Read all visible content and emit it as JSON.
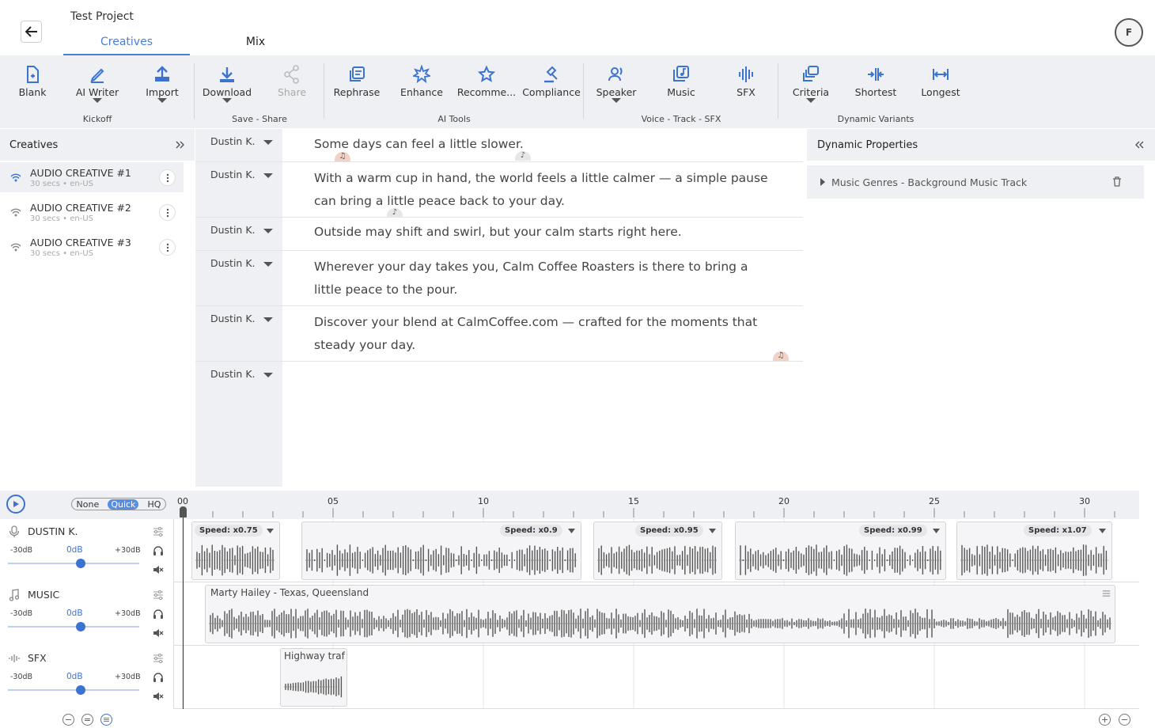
{
  "header": {
    "project_title": "Test Project",
    "tabs": [
      {
        "label": "Creatives",
        "active": true
      },
      {
        "label": "Mix",
        "active": false
      }
    ],
    "avatar_initial": "F"
  },
  "ribbon": {
    "buttons": [
      {
        "label": "Blank",
        "icon": "file-icon",
        "group": "kickoff"
      },
      {
        "label": "AI Writer",
        "icon": "pen-icon",
        "group": "kickoff",
        "dropdown": true
      },
      {
        "label": "Import",
        "icon": "upload-icon",
        "group": "kickoff",
        "dropdown": true
      },
      {
        "label": "Download",
        "icon": "download-icon",
        "group": "save",
        "dropdown": true
      },
      {
        "label": "Share",
        "icon": "share-icon",
        "group": "save",
        "disabled": true
      },
      {
        "label": "Rephrase",
        "icon": "rephrase-icon",
        "group": "ai"
      },
      {
        "label": "Enhance",
        "icon": "enhance-icon",
        "group": "ai"
      },
      {
        "label": "Recomme...",
        "icon": "star-icon",
        "group": "ai"
      },
      {
        "label": "Compliance",
        "icon": "gavel-icon",
        "group": "ai"
      },
      {
        "label": "Speaker",
        "icon": "speaker-icon",
        "group": "voice",
        "dropdown": true
      },
      {
        "label": "Music",
        "icon": "music-library-icon",
        "group": "voice"
      },
      {
        "label": "SFX",
        "icon": "sfx-icon",
        "group": "voice"
      },
      {
        "label": "Criteria",
        "icon": "criteria-icon",
        "group": "variants",
        "dropdown": true
      },
      {
        "label": "Shortest",
        "icon": "shortest-icon",
        "group": "variants"
      },
      {
        "label": "Longest",
        "icon": "longest-icon",
        "group": "variants"
      }
    ],
    "groups": {
      "kickoff": "Kickoff",
      "save": "Save - Share",
      "ai": "AI Tools",
      "voice": "Voice - Track - SFX",
      "variants": "Dynamic Variants"
    }
  },
  "creatives_panel": {
    "title": "Creatives",
    "items": [
      {
        "name": "AUDIO CREATIVE #1",
        "meta": "30 secs • en-US",
        "selected": true
      },
      {
        "name": "AUDIO CREATIVE #2",
        "meta": "30 secs • en-US",
        "selected": false
      },
      {
        "name": "AUDIO CREATIVE #3",
        "meta": "30 secs • en-US",
        "selected": false
      }
    ]
  },
  "script": {
    "lines": [
      {
        "speaker": "Dustin K.",
        "text": "Some days can feel a little slower."
      },
      {
        "speaker": "Dustin K.",
        "text": "With a warm cup in hand, the world feels a little calmer — a simple pause can bring a little peace back to your day."
      },
      {
        "speaker": "Dustin K.",
        "text": "Outside may shift and swirl, but your calm starts right here."
      },
      {
        "speaker": "Dustin K.",
        "text": "Wherever your day takes you, Calm Coffee Roasters is there to bring a little peace to the pour."
      },
      {
        "speaker": "Dustin K.",
        "text": "Discover your blend at CalmCoffee.com — crafted for the moments that steady your day."
      },
      {
        "speaker": "Dustin K.",
        "text": ""
      }
    ]
  },
  "dynamic_panel": {
    "title": "Dynamic Properties",
    "rows": [
      {
        "label": "Music Genres - Background Music Track"
      }
    ]
  },
  "timeline": {
    "quality": {
      "options": [
        "None",
        "Quick",
        "HQ"
      ],
      "selected": "Quick"
    },
    "ticks": [
      "00",
      "05",
      "10",
      "15",
      "20",
      "25",
      "30"
    ],
    "tracks": [
      {
        "name": "DUSTIN K.",
        "icon": "mic-icon",
        "min_db": "-30dB",
        "cur_db": "0dB",
        "max_db": "+30dB"
      },
      {
        "name": "MUSIC",
        "icon": "note-icon",
        "min_db": "-30dB",
        "cur_db": "0dB",
        "max_db": "+30dB"
      },
      {
        "name": "SFX",
        "icon": "waveform-icon",
        "min_db": "-30dB",
        "cur_db": "0dB",
        "max_db": "+30dB"
      }
    ],
    "voice_clips": [
      {
        "speed": "Speed: x0.75"
      },
      {
        "speed": "Speed: x0.9"
      },
      {
        "speed": "Speed: x0.95"
      },
      {
        "speed": "Speed: x0.99"
      },
      {
        "speed": "Speed: x1.07"
      }
    ],
    "music_clip": {
      "title": "Marty Hailey - Texas, Queensland"
    },
    "sfx_clip": {
      "title": "Highway traf"
    }
  },
  "colors": {
    "accent": "#4a7fd6",
    "panel_bg": "#eef0f3"
  }
}
